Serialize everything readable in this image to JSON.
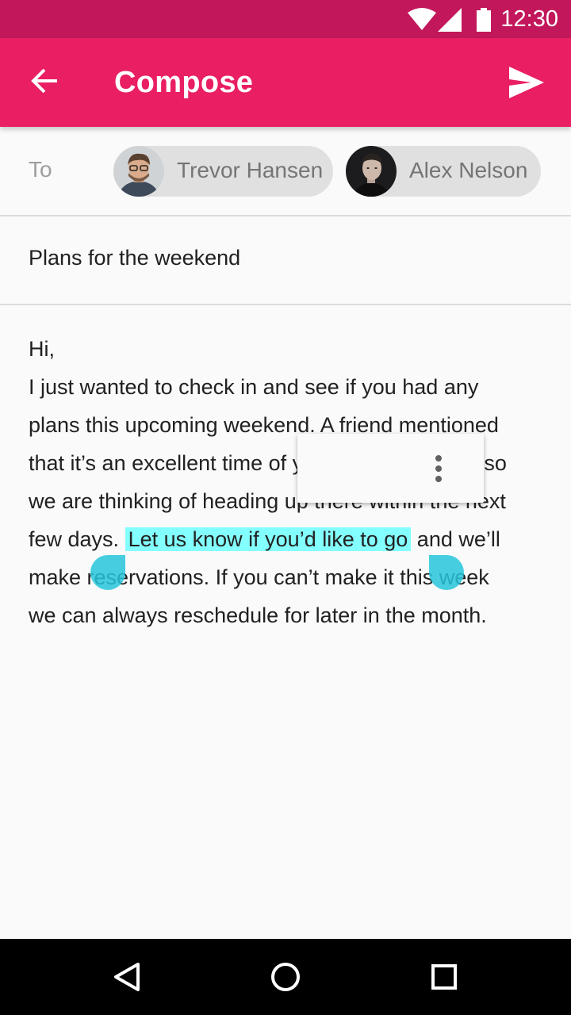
{
  "status_bar": {
    "time": "12:30",
    "icons": [
      "wifi-icon",
      "cell-signal-icon",
      "battery-icon"
    ]
  },
  "app_bar": {
    "title": "Compose",
    "back_icon": "arrow-back-icon",
    "send_icon": "send-icon"
  },
  "recipients": {
    "label": "To",
    "chips": [
      {
        "name": "Trevor Hansen",
        "avatar": "avatar-trevor"
      },
      {
        "name": "Alex Nelson",
        "avatar": "avatar-alex"
      }
    ]
  },
  "subject": "Plans for the weekend",
  "body": {
    "line1": "Hi,",
    "line2": "I just wanted to check in and see if you had any",
    "line3": "plans this upcoming weekend. A friend mentioned",
    "line4": "that it’s an excellent time of year to go up there, so",
    "line5": "we are thinking of heading up there within the next",
    "line6_before": "few days.",
    "line6_selected": "Let us know if you’d like to go",
    "line6_after": "and we’ll",
    "line7": "make reservations. If you can’t make it this week",
    "line8": "we can always reschedule for later in the month."
  },
  "selection_toolbar": {
    "overflow_icon": "more-vert-icon"
  },
  "nav_bar": {
    "icons": [
      "back-triangle-icon",
      "home-circle-icon",
      "recents-square-icon"
    ]
  },
  "colors": {
    "primary": "#e91e63",
    "primary_dark": "#c2185b",
    "selection": "#84ffff",
    "handle": "#26c6da"
  }
}
